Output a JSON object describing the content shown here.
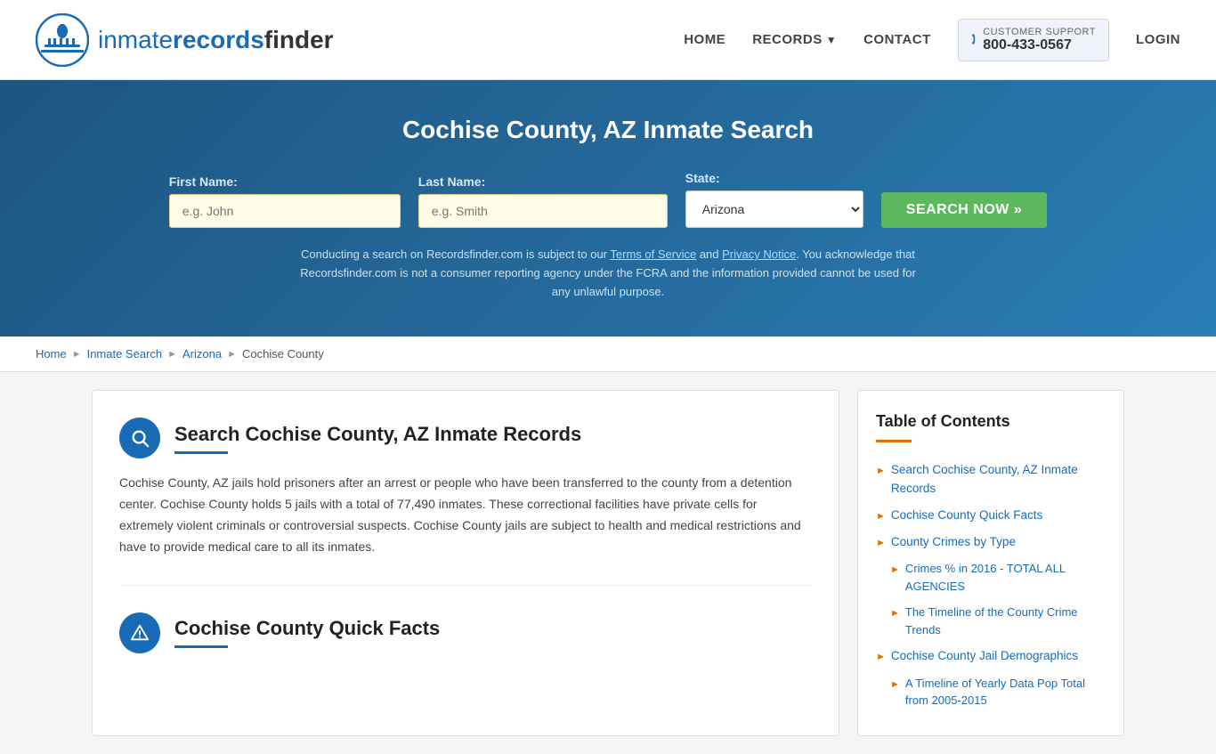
{
  "header": {
    "logo_text_inmate": "inmate",
    "logo_text_records": "records",
    "logo_text_finder": "finder",
    "nav": {
      "home": "HOME",
      "records": "RECORDS",
      "contact": "CONTACT",
      "login": "LOGIN"
    },
    "support": {
      "label": "CUSTOMER SUPPORT",
      "phone": "800-433-0567"
    }
  },
  "hero": {
    "title": "Cochise County, AZ Inmate Search",
    "first_name_label": "First Name:",
    "first_name_placeholder": "e.g. John",
    "last_name_label": "Last Name:",
    "last_name_placeholder": "e.g. Smith",
    "state_label": "State:",
    "state_value": "Arizona",
    "search_button": "SEARCH NOW »",
    "disclaimer": "Conducting a search on Recordsfinder.com is subject to our Terms of Service and Privacy Notice. You acknowledge that Recordsfinder.com is not a consumer reporting agency under the FCRA and the information provided cannot be used for any unlawful purpose.",
    "disclaimer_tos": "Terms of Service",
    "disclaimer_privacy": "Privacy Notice"
  },
  "breadcrumb": {
    "home": "Home",
    "inmate_search": "Inmate Search",
    "arizona": "Arizona",
    "current": "Cochise County"
  },
  "main": {
    "section1": {
      "title": "Search Cochise County, AZ Inmate Records",
      "body": "Cochise County, AZ jails hold prisoners after an arrest or people who have been transferred to the county from a detention center. Cochise County holds 5 jails with a total of 77,490 inmates. These correctional facilities have private cells for extremely violent criminals or controversial suspects. Cochise County jails are subject to health and medical restrictions and have to provide medical care to all its inmates."
    },
    "section2": {
      "title": "Cochise County Quick Facts"
    }
  },
  "toc": {
    "title": "Table of Contents",
    "items": [
      {
        "label": "Search Cochise County, AZ Inmate Records",
        "sub": false
      },
      {
        "label": "Cochise County Quick Facts",
        "sub": false
      },
      {
        "label": "County Crimes by Type",
        "sub": false
      },
      {
        "label": "Crimes % in 2016 - TOTAL ALL AGENCIES",
        "sub": true
      },
      {
        "label": "The Timeline of the County Crime Trends",
        "sub": true
      },
      {
        "label": "Cochise County Jail Demographics",
        "sub": false
      },
      {
        "label": "A Timeline of Yearly Data Pop Total from 2005-2015",
        "sub": true
      }
    ]
  }
}
